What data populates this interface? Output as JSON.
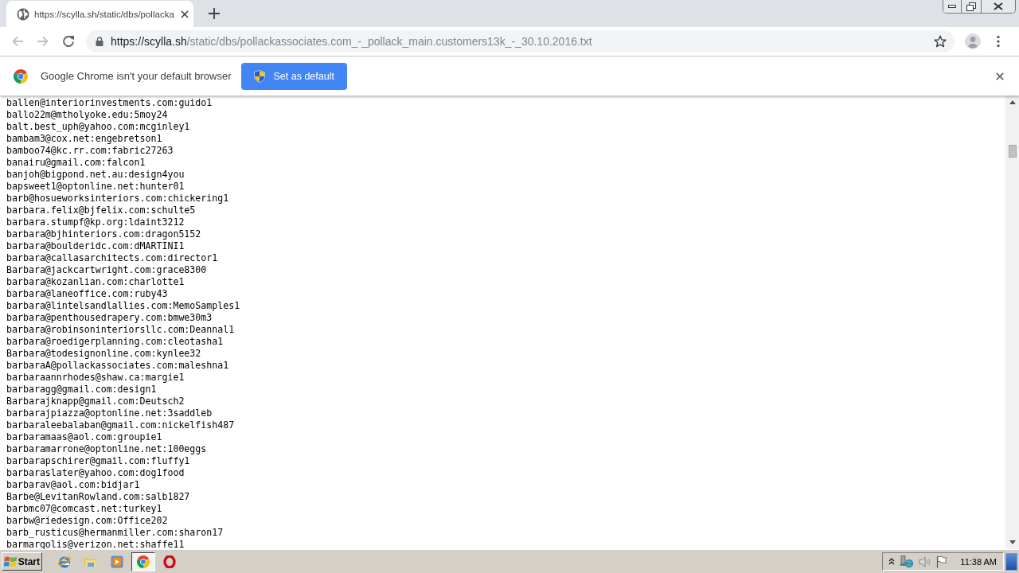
{
  "tabs": [
    {
      "title": "https://scylla.sh/static/dbs/pollacka",
      "selected": true
    }
  ],
  "toolbar": {
    "back": {
      "disabled": true
    },
    "forward": {
      "disabled": true
    },
    "address": {
      "origin": "https://scylla.sh",
      "path": "/static/dbs/pollackassociates.com_-_pollack_main.customers13k_-_30.10.2016.txt"
    }
  },
  "infobar": {
    "message": "Google Chrome isn't your default browser",
    "button": "Set as default"
  },
  "document": {
    "lines": [
      "ballen@interiorinvestments.com:guido1",
      "ballo22m@mtholyoke.edu:5moy24",
      "balt.best_uph@yahoo.com:mcginley1",
      "bambam3@cox.net:engebretson1",
      "bamboo74@kc.rr.com:fabric27263",
      "banairu@gmail.com:falcon1",
      "banjoh@bigpond.net.au:design4you",
      "bapsweet1@optonline.net:hunter01",
      "barb@hosueworksinteriors.com:chickering1",
      "barbara.felix@bjfelix.com:schulte5",
      "barbara.stumpf@kp.org:ldaint3212",
      "barbara@bjhinteriors.com:dragon5152",
      "barbara@boulderidc.com:dMARTINI1",
      "barbara@callasarchitects.com:director1",
      "Barbara@jackcartwright.com:grace8300",
      "barbara@kozanlian.com:charlotte1",
      "barbara@laneoffice.com:ruby43",
      "barbara@lintelsandlallies.com:MemoSamples1",
      "barbara@penthousedrapery.com:bmwe30m3",
      "barbara@robinsoninteriorsllc.com:Deannal1",
      "barbara@roedigerplanning.com:cleotasha1",
      "Barbara@todesignonline.com:kynlee32",
      "barbaraA@pollackassociates.com:maleshna1",
      "barbaraannrhodes@shaw.ca:margie1",
      "barbaragg@gmail.com:design1",
      "Barbarajknapp@gmail.com:Deutsch2",
      "barbarajpiazza@optonline.net:3saddleb",
      "barbaraleebalaban@gmail.com:nickelfish487",
      "barbaramaas@aol.com:groupie1",
      "barbaramarrone@optonline.net:100eggs",
      "barbarapschirer@gmail.com:fluffy1",
      "barbaraslater@yahoo.com:dog1food",
      "barbarav@aol.com:bidjar1",
      "Barbe@LevitanRowland.com:salb1827",
      "barbmc07@comcast.net:turkey1",
      "barbw@riedesign.com:Office202",
      "barb_rusticus@hermanmiller.com:sharon17",
      "barmargolis@verizon.net:shaffe11"
    ]
  },
  "taskbar": {
    "start": "Start",
    "apps": [
      {
        "kind": "ie",
        "selected": false
      },
      {
        "kind": "explorer",
        "selected": false
      },
      {
        "kind": "media",
        "selected": false
      },
      {
        "kind": "chrome",
        "selected": true
      },
      {
        "kind": "opera",
        "selected": false
      }
    ],
    "clock": "11:38 AM"
  }
}
